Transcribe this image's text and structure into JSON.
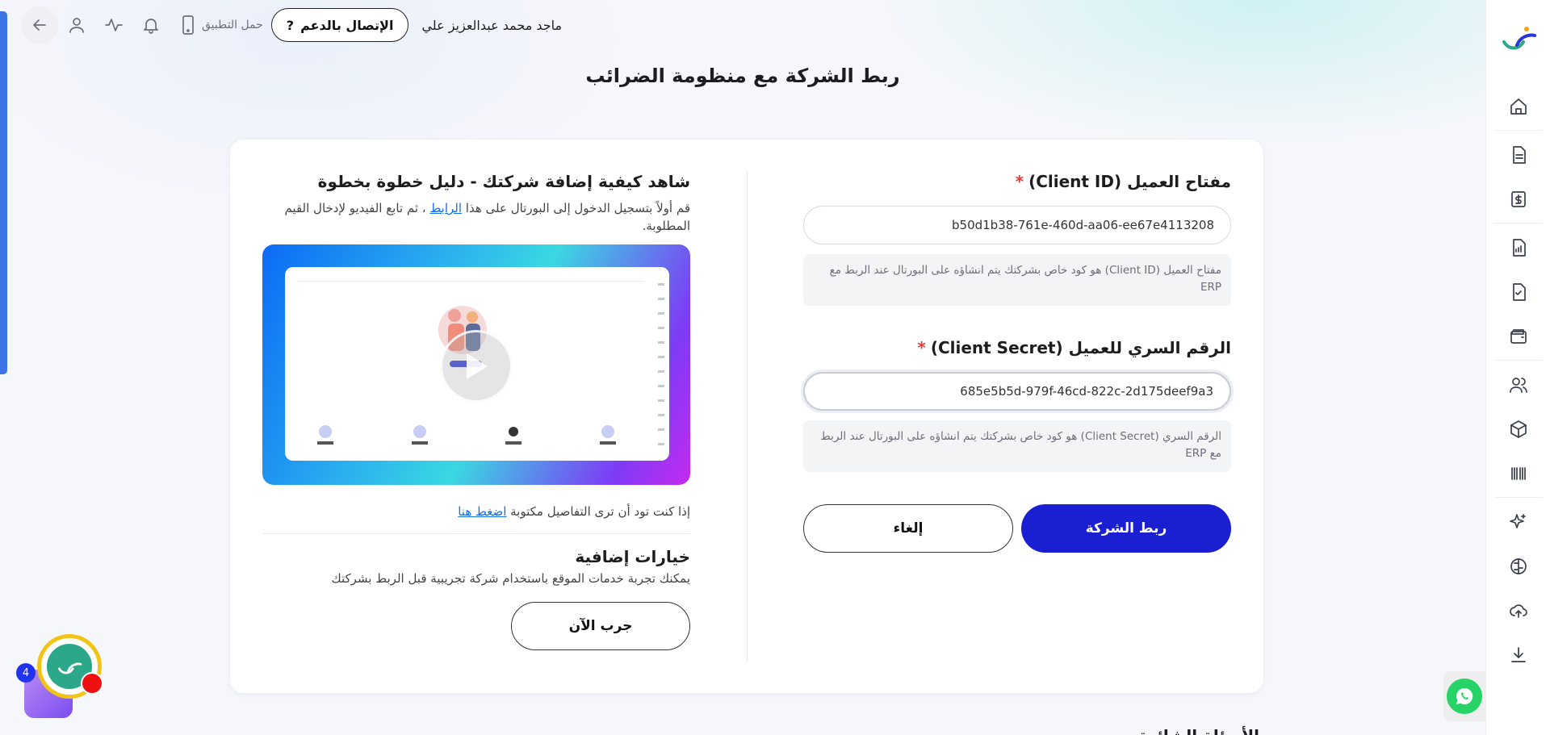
{
  "header": {
    "user_name": "ماجد محمد عبدالعزيز علي",
    "support_label": "الإتصال بالدعم",
    "support_icon": "?",
    "get_app_label": "حمل التطبيق"
  },
  "page": {
    "title": "ربط الشركة مع منظومة الضرائب"
  },
  "form": {
    "client_id_label": "مفتاح العميل (Client ID)",
    "client_id_value": "b50d1b38-761e-460d-aa06-ee67e4113208",
    "client_id_hint": "مفتاح العميل (Client ID) هو كود خاص بشركتك يتم انشاؤه على البورتال عند الربط مع ERP",
    "client_secret_label": "الرقم السري للعميل (Client Secret)",
    "client_secret_value": "685e5b5d-979f-46cd-822c-2d175deef9a3",
    "client_secret_hint": "الرقم السري (Client Secret) هو كود خاص بشركتك يتم انشاؤه على البورتال عند الربط مع ERP",
    "required_mark": "*",
    "submit_label": "ربط الشركة",
    "cancel_label": "إلغاء"
  },
  "guide": {
    "title": "شاهد كيفية إضافة شركتك - دليل خطوة بخطوة",
    "desc_before": "قم أولاً بتسجيل الدخول إلى البورتال على هذا ",
    "desc_link": "الرابط",
    "desc_after": " ، ثم تابع الفيديو لإدخال القيم المطلوبة.",
    "written_prefix": "إذا كنت تود أن ترى التفاصيل مكتوبة ",
    "written_link": "اضغط هنا",
    "extra_title": "خيارات إضافية",
    "extra_desc": "يمكنك تجربة خدمات الموقع باستخدام شركة تجريبية قبل الربط بشركتك",
    "try_label": "جرب الآن"
  },
  "below": {
    "heading_partial": "الأسئلة الشائعة"
  },
  "widgets": {
    "helper_badge": "4"
  },
  "sidebar_icons": [
    "home-icon",
    "document-icon",
    "invoice-dollar-icon",
    "report-icon",
    "checklist-icon",
    "wallet-icon",
    "users-icon",
    "box-icon",
    "barcode-icon",
    "sparkle-icon",
    "brain-icon",
    "upload-cloud-icon",
    "download-icon"
  ],
  "colors": {
    "primary": "#1a1fd1",
    "link": "#1a6fe0",
    "required": "#e23b3b",
    "whatsapp": "#25d366"
  }
}
